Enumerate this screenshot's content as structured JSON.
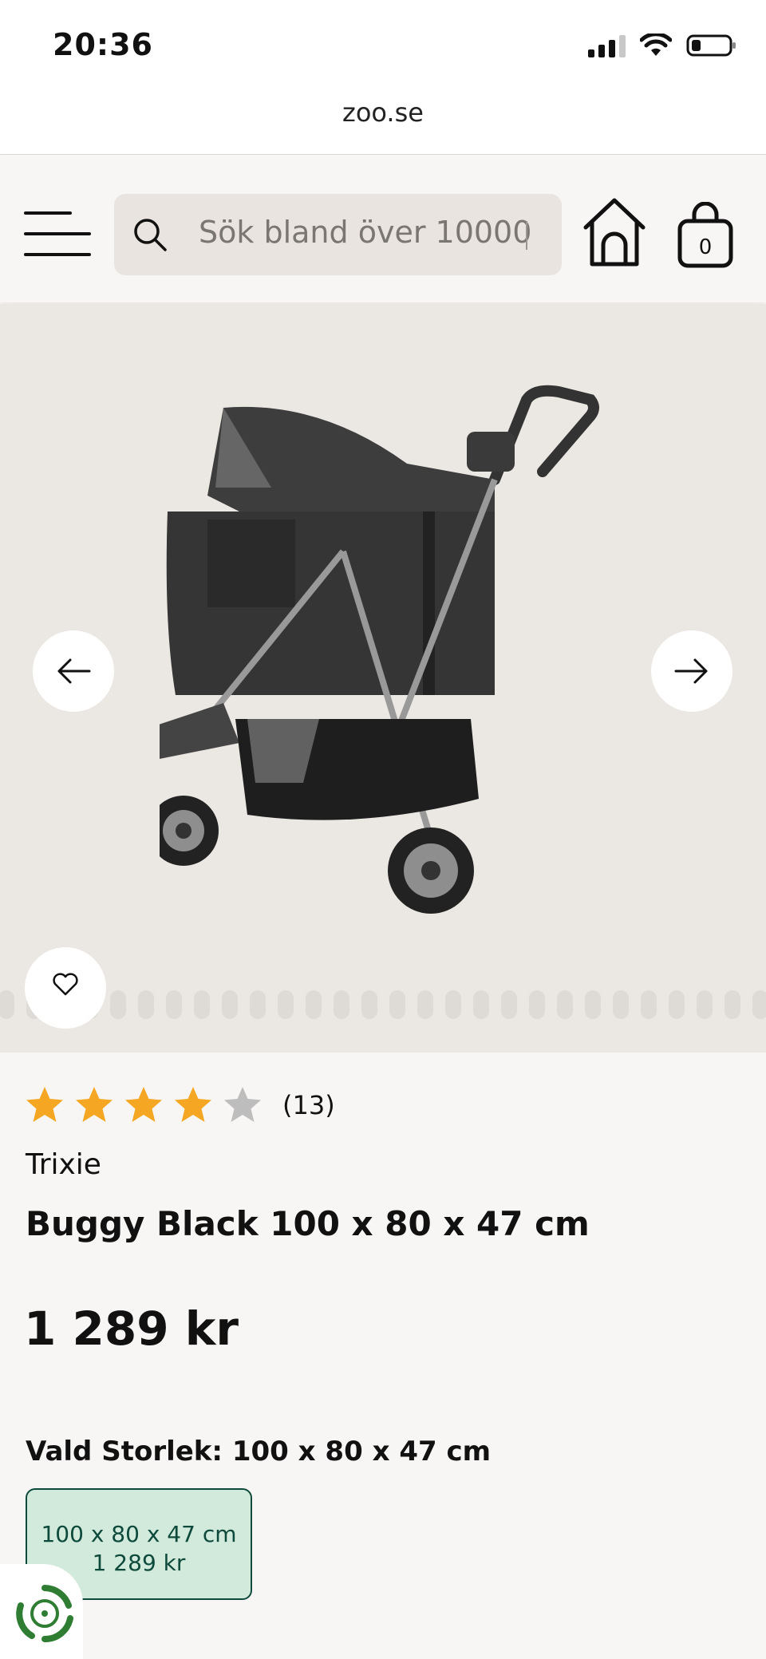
{
  "status_bar": {
    "time": "20:36",
    "battery_level": 0.25
  },
  "browser": {
    "url": "zoo.se"
  },
  "header": {
    "search_placeholder": "Sök bland över 10000",
    "cart_count": "0"
  },
  "gallery": {
    "total_images": 28,
    "active_index": 3
  },
  "product": {
    "rating": 4,
    "rating_max": 5,
    "review_count": "(13)",
    "brand": "Trixie",
    "title": "Buggy Black 100 x 80 x 47 cm",
    "price": "1 289 kr"
  },
  "size": {
    "selected_label": "Vald Storlek: 100 x 80 x 47 cm",
    "options": [
      {
        "size": "100 x 80 x 47 cm",
        "price": "1 289 kr"
      }
    ]
  },
  "colors": {
    "star_filled": "#f5a623",
    "star_empty": "#bdbdbd",
    "size_option_bg": "#d2eadb",
    "size_option_border": "#0e4a3c",
    "recycle_green": "#2e7d32"
  }
}
